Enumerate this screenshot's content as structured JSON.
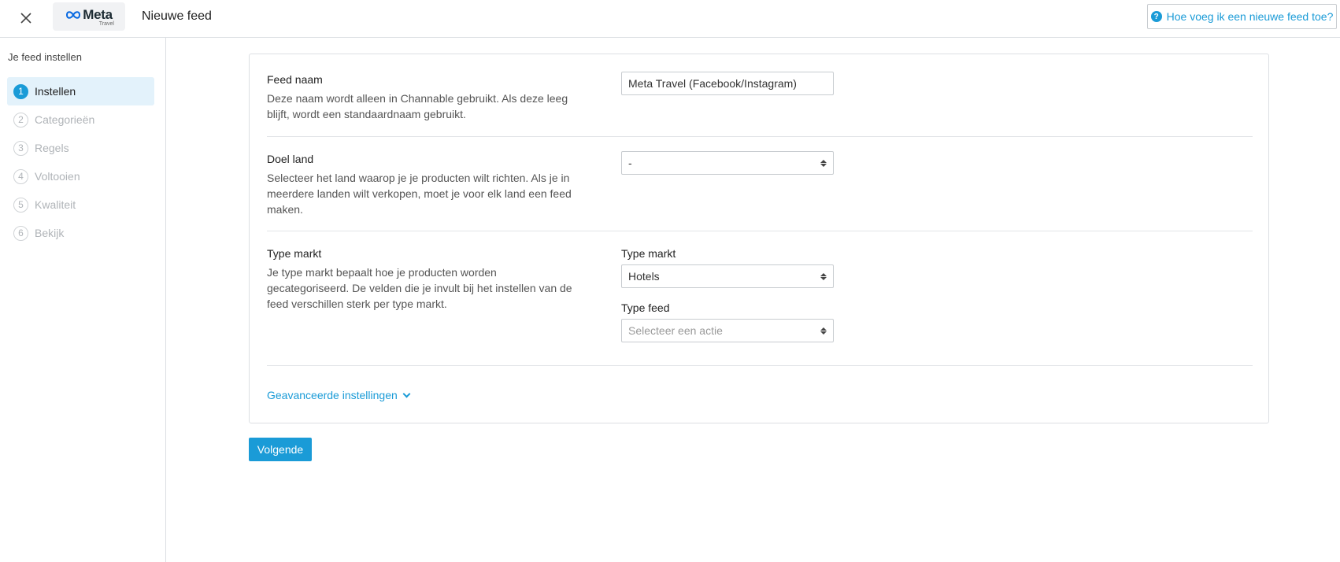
{
  "header": {
    "logo_text": "Meta",
    "logo_sub": "Travel",
    "title": "Nieuwe feed",
    "help_label": "Hoe voeg ik een nieuwe feed toe?"
  },
  "sidebar": {
    "title": "Je feed instellen",
    "steps": [
      {
        "num": "1",
        "label": "Instellen",
        "active": true
      },
      {
        "num": "2",
        "label": "Categorieën",
        "active": false
      },
      {
        "num": "3",
        "label": "Regels",
        "active": false
      },
      {
        "num": "4",
        "label": "Voltooien",
        "active": false
      },
      {
        "num": "5",
        "label": "Kwaliteit",
        "active": false
      },
      {
        "num": "6",
        "label": "Bekijk",
        "active": false
      }
    ]
  },
  "form": {
    "feed_name": {
      "title": "Feed naam",
      "desc": "Deze naam wordt alleen in Channable gebruikt. Als deze leeg blijft, wordt een standaardnaam gebruikt.",
      "value": "Meta Travel (Facebook/Instagram)"
    },
    "target_country": {
      "title": "Doel land",
      "desc": "Selecteer het land waarop je je producten wilt richten. Als je in meerdere landen wilt verkopen, moet je voor elk land een feed maken.",
      "value": "-"
    },
    "market_type": {
      "title": "Type markt",
      "desc": "Je type markt bepaalt hoe je producten worden gecategoriseerd. De velden die je invult bij het instellen van de feed verschillen sterk per type markt.",
      "market_label": "Type markt",
      "market_value": "Hotels",
      "feed_label": "Type feed",
      "feed_placeholder": "Selecteer een actie"
    },
    "advanced_label": "Geavanceerde instellingen"
  },
  "footer": {
    "next_label": "Volgende"
  },
  "colors": {
    "accent": "#1a9bd7",
    "active_step_bg": "#e3f2fb"
  }
}
